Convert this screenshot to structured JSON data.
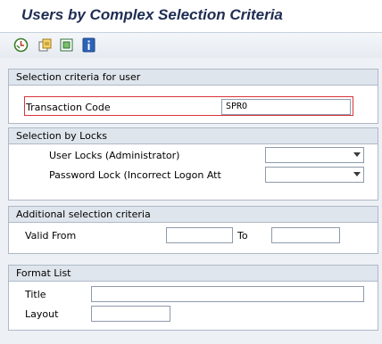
{
  "window": {
    "title": "Users by Complex Selection Criteria"
  },
  "toolbar": {
    "buttons": [
      {
        "name": "execute-icon"
      },
      {
        "name": "get-variant-icon"
      },
      {
        "name": "selection-options-icon"
      },
      {
        "name": "information-icon"
      }
    ]
  },
  "groups": {
    "user": {
      "header": "Selection criteria for user",
      "transaction_code_label": "Transaction Code",
      "transaction_code_value": "SPRO"
    },
    "locks": {
      "header": "Selection by Locks",
      "user_locks_label": "User Locks (Administrator)",
      "user_locks_value": "",
      "password_lock_label": "Password Lock (Incorrect Logon Att",
      "password_lock_value": ""
    },
    "additional": {
      "header": "Additional selection criteria",
      "valid_from_label": "Valid From",
      "valid_from_value": "",
      "to_label": "To",
      "to_value": ""
    },
    "format": {
      "header": "Format List",
      "title_label": "Title",
      "title_value": "",
      "layout_label": "Layout",
      "layout_value": ""
    }
  },
  "colors": {
    "title_text": "#1f2d52",
    "highlight_border": "#d9343a",
    "group_header_bg": "#dfe5ec"
  }
}
